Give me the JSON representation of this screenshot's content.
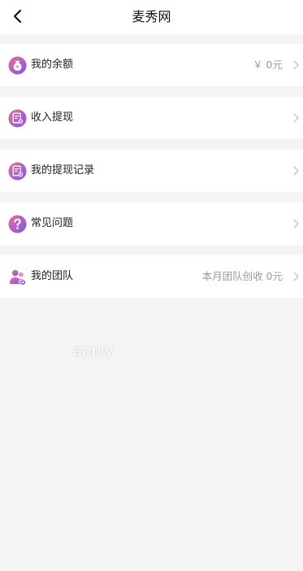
{
  "header": {
    "title": "麦秀网",
    "back_icon": "chevron-left-icon"
  },
  "menu": [
    {
      "label": "我的余额",
      "value": "￥ 0元",
      "icon": "money-bag-icon"
    },
    {
      "label": "收入提现",
      "value": "",
      "icon": "withdraw-document-icon"
    },
    {
      "label": "我的提现记录",
      "value": "",
      "icon": "record-document-icon"
    },
    {
      "label": "常见问题",
      "value": "",
      "icon": "question-icon"
    },
    {
      "label": "我的团队",
      "value": "本月团队创收 0元",
      "icon": "team-icon"
    }
  ],
  "overlay_text": "apply",
  "colors": {
    "background": "#f4f4f4",
    "icon_gradient_start": "#f06a9c",
    "icon_gradient_end": "#7a57e8"
  }
}
